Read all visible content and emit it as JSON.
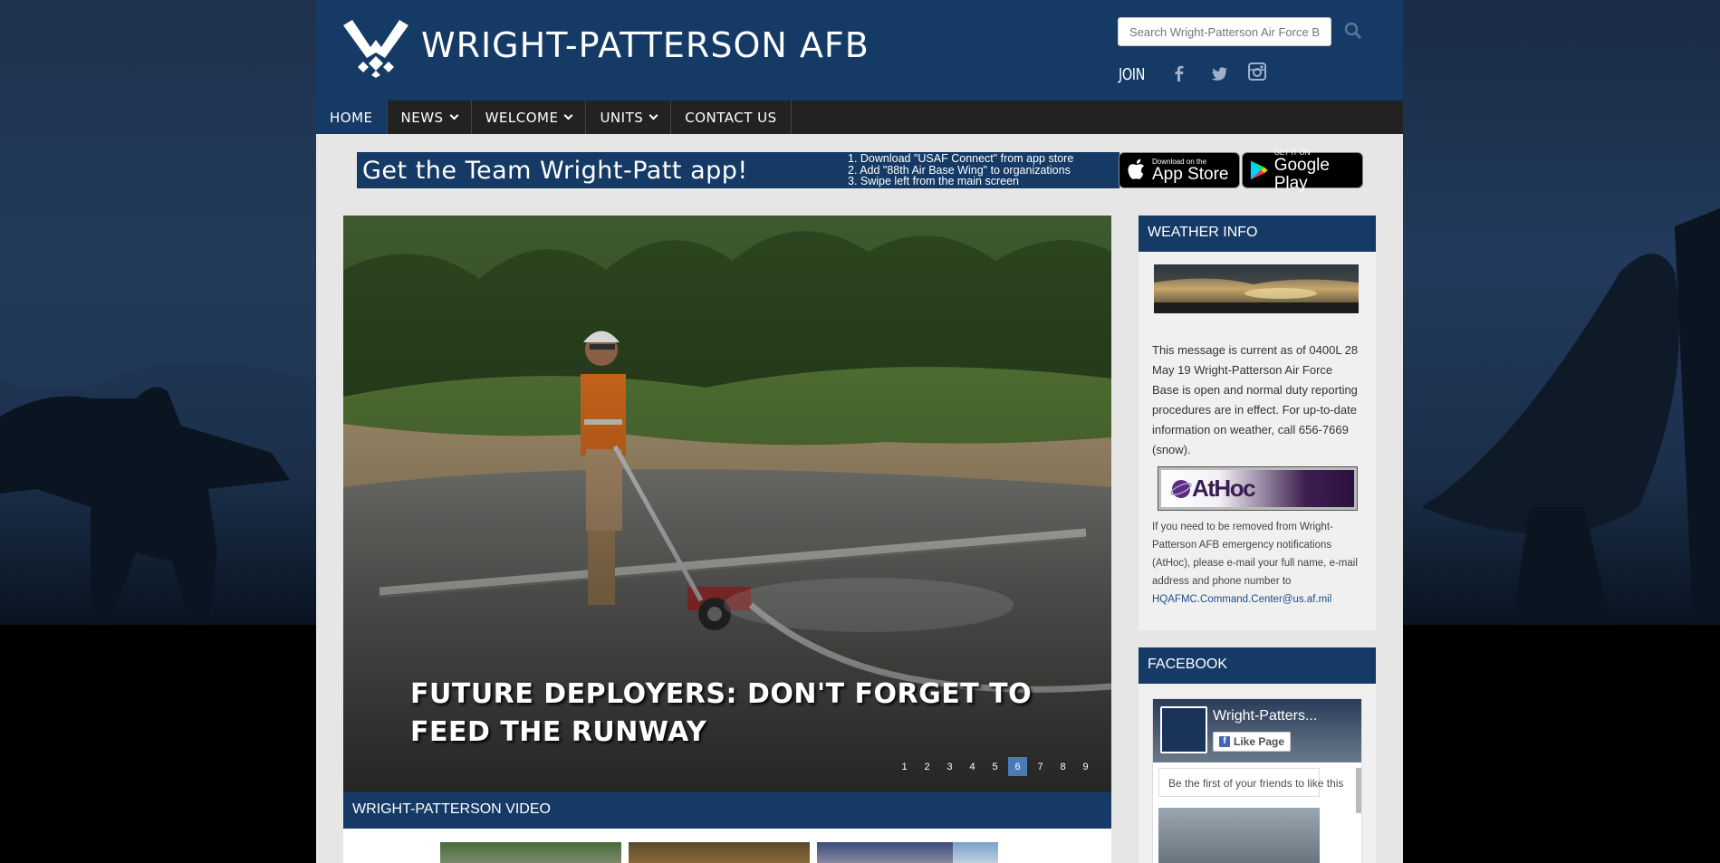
{
  "header": {
    "site_title": "WRIGHT-PATTERSON AFB",
    "search_placeholder": "Search Wright-Patterson Air Force Base",
    "join_label": "JOIN",
    "social": [
      "facebook-icon",
      "twitter-icon",
      "instagram-icon"
    ]
  },
  "nav": {
    "items": [
      {
        "label": "HOME",
        "active": true,
        "dropdown": false
      },
      {
        "label": "NEWS",
        "active": false,
        "dropdown": true
      },
      {
        "label": "WELCOME",
        "active": false,
        "dropdown": true
      },
      {
        "label": "UNITS",
        "active": false,
        "dropdown": true
      },
      {
        "label": "CONTACT US",
        "active": false,
        "dropdown": false
      }
    ]
  },
  "app_banner": {
    "title": "Get the  Team Wright-Patt app!",
    "steps": [
      "1. Download \"USAF Connect\" from app store",
      "2. Add \"88th Air Base Wing\" to organizations",
      "3. Swipe left from the main screen"
    ],
    "app_store": {
      "small": "Download on the",
      "big": "App Store"
    },
    "google_play": {
      "small": "GET IT ON",
      "big": "Google Play"
    }
  },
  "carousel": {
    "caption": "FUTURE DEPLOYERS: DON'T FORGET TO FEED THE RUNWAY",
    "pages": [
      "1",
      "2",
      "3",
      "4",
      "5",
      "6",
      "7",
      "8",
      "9"
    ],
    "active_page": "6"
  },
  "video": {
    "heading": "WRIGHT-PATTERSON VIDEO"
  },
  "weather": {
    "heading": "WEATHER INFO",
    "message": "This message is current  as of 0400L 28 May 19 Wright-Patterson Air Force Base is open and normal duty reporting procedures are in effect. For up-to-date information on weather, call 656-7669 (snow).",
    "athoc_logo": "AtHoc",
    "athoc_text": "If you need to be removed from Wright-Patterson AFB emergency notifications (AtHoc), please e-mail your full name, e-mail address and phone number to",
    "athoc_email": "HQAFMC.Command.Center@us.af.mil"
  },
  "facebook": {
    "heading": "FACEBOOK",
    "page_name": "Wright-Patters...",
    "like_label": "Like Page",
    "friends_text": "Be the first of your friends to like this"
  },
  "colors": {
    "header_blue": "#153a66",
    "nav_dark": "#222222",
    "active_pager": "#4a7ab8"
  }
}
